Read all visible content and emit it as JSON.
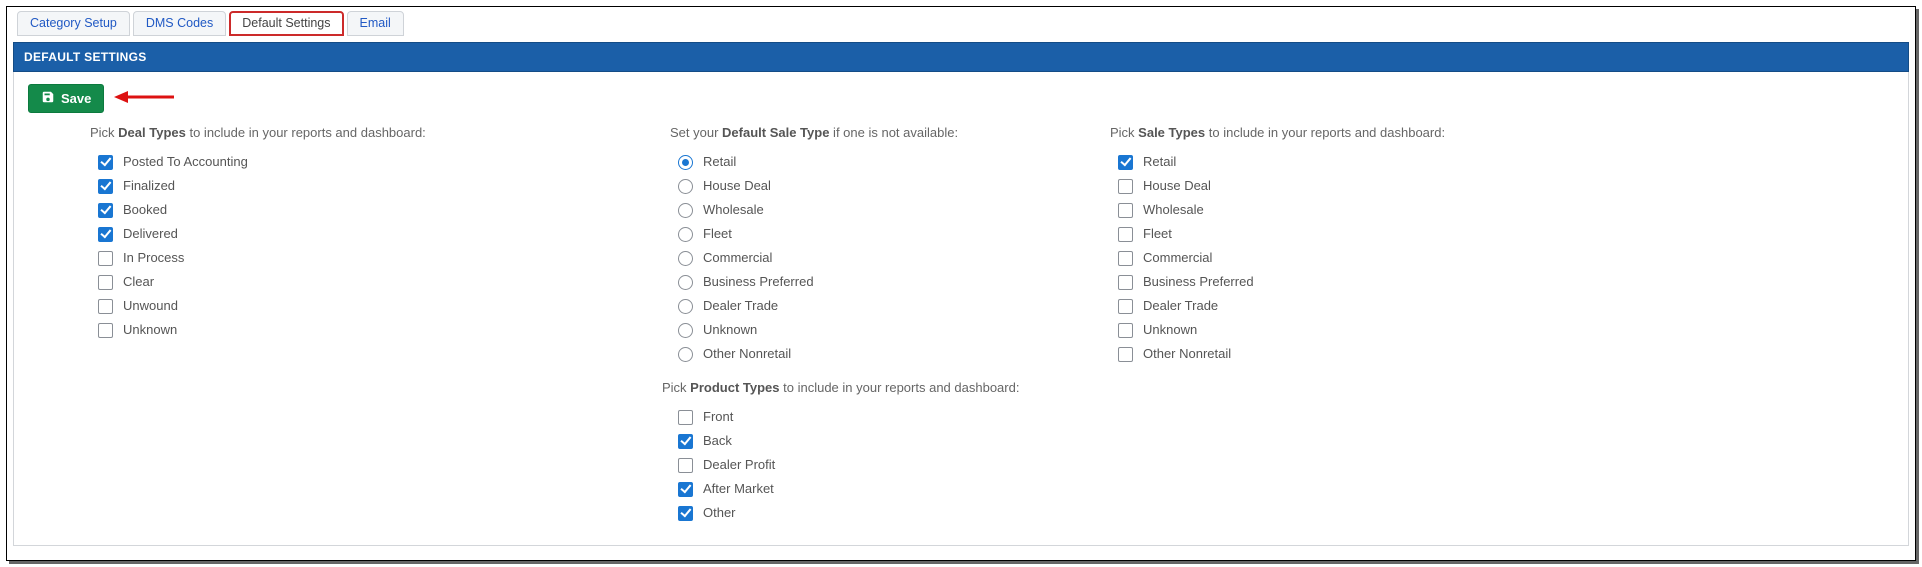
{
  "tabs": [
    {
      "label": "Category Setup",
      "active": false
    },
    {
      "label": "DMS Codes",
      "active": false
    },
    {
      "label": "Default Settings",
      "active": true
    },
    {
      "label": "Email",
      "active": false
    }
  ],
  "panel_title": "DEFAULT SETTINGS",
  "save_label": "Save",
  "deal_types": {
    "title_pre": "Pick ",
    "title_bold": "Deal Types",
    "title_post": " to include in your reports and dashboard:",
    "items": [
      {
        "label": "Posted To Accounting",
        "checked": true
      },
      {
        "label": "Finalized",
        "checked": true
      },
      {
        "label": "Booked",
        "checked": true
      },
      {
        "label": "Delivered",
        "checked": true
      },
      {
        "label": "In Process",
        "checked": false
      },
      {
        "label": "Clear",
        "checked": false
      },
      {
        "label": "Unwound",
        "checked": false
      },
      {
        "label": "Unknown",
        "checked": false
      }
    ]
  },
  "default_sale_type": {
    "title_pre": "Set your ",
    "title_bold": "Default Sale Type",
    "title_post": " if one is not available:",
    "items": [
      {
        "label": "Retail",
        "checked": true
      },
      {
        "label": "House Deal",
        "checked": false
      },
      {
        "label": "Wholesale",
        "checked": false
      },
      {
        "label": "Fleet",
        "checked": false
      },
      {
        "label": "Commercial",
        "checked": false
      },
      {
        "label": "Business Preferred",
        "checked": false
      },
      {
        "label": "Dealer Trade",
        "checked": false
      },
      {
        "label": "Unknown",
        "checked": false
      },
      {
        "label": "Other Nonretail",
        "checked": false
      }
    ]
  },
  "product_types": {
    "title_pre": "Pick ",
    "title_bold": "Product Types",
    "title_post": " to include in your reports and dashboard:",
    "items": [
      {
        "label": "Front",
        "checked": false
      },
      {
        "label": "Back",
        "checked": true
      },
      {
        "label": "Dealer Profit",
        "checked": false
      },
      {
        "label": "After Market",
        "checked": true
      },
      {
        "label": "Other",
        "checked": true
      }
    ]
  },
  "sale_types": {
    "title_pre": "Pick ",
    "title_bold": "Sale Types",
    "title_post": " to include in your reports and dashboard:",
    "items": [
      {
        "label": "Retail",
        "checked": true
      },
      {
        "label": "House Deal",
        "checked": false
      },
      {
        "label": "Wholesale",
        "checked": false
      },
      {
        "label": "Fleet",
        "checked": false
      },
      {
        "label": "Commercial",
        "checked": false
      },
      {
        "label": "Business Preferred",
        "checked": false
      },
      {
        "label": "Dealer Trade",
        "checked": false
      },
      {
        "label": "Unknown",
        "checked": false
      },
      {
        "label": "Other Nonretail",
        "checked": false
      }
    ]
  }
}
